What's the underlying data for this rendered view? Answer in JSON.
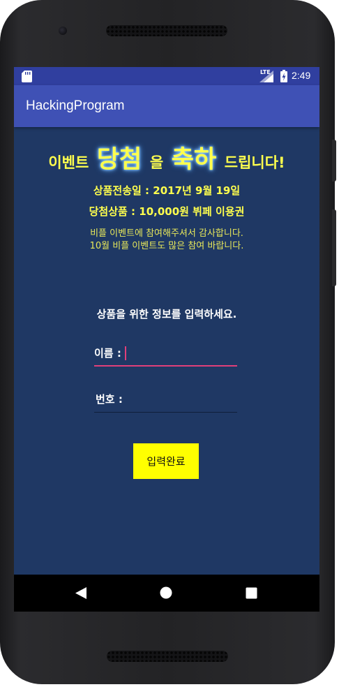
{
  "status_bar": {
    "time": "2:49",
    "network": "LTE",
    "icons": [
      "sd-card-icon",
      "signal-icon",
      "battery-icon"
    ]
  },
  "app_bar": {
    "title": "HackingProgram",
    "color": "#3f51b5"
  },
  "event": {
    "headline": {
      "part1": "이벤트",
      "big1": "당첨",
      "part2": "을",
      "big2": "축하",
      "part3": "드립니다!"
    },
    "send_date": "상품전송일 : 2017년 9월 19일",
    "prize": "당첨상품 : 10,000원 뷔페 이용권",
    "thanks": "비플 이벤트에 참여해주셔서 감사합니다.",
    "next": "10월 비플 이벤트도 많은 참여 바랍니다."
  },
  "form": {
    "instruction": "상품을 위한 정보를 입력하세요.",
    "name_label": "이름 :",
    "name_value": "",
    "phone_label": "번호 :",
    "phone_value": "",
    "submit_label": "입력완료"
  },
  "navigation": {
    "buttons": [
      "back-icon",
      "home-icon",
      "recents-icon"
    ]
  },
  "colors": {
    "status_bar": "#303f9f",
    "app_bar": "#3f51b5",
    "background": "#1f3864",
    "accent_text": "#ffff4d",
    "focus_underline": "#e0407a",
    "button": "#ffff00"
  }
}
